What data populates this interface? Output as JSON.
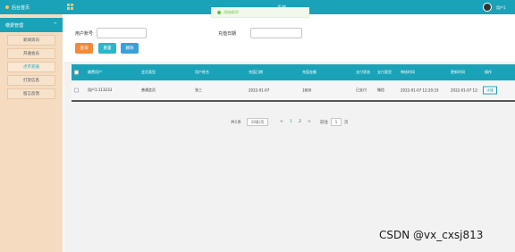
{
  "sidebar": {
    "home_label": "后台首页",
    "group_label": "缴费管理",
    "group_caret": "^",
    "items": [
      {
        "label": "新闻资讯",
        "active": false
      },
      {
        "label": "开通会员",
        "active": false
      },
      {
        "label": "点币充值",
        "active": true
      },
      {
        "label": "打赏信息",
        "active": false
      },
      {
        "label": "留言反馈",
        "active": false
      }
    ]
  },
  "topbar": {
    "title": "系统",
    "user_name": "用户1"
  },
  "toast": {
    "message": "添加成功!"
  },
  "search": {
    "user_account_label": "用户账号",
    "user_account_value": "",
    "recharge_date_label": "充值日期",
    "recharge_date_value": ""
  },
  "buttons": {
    "query": "查询",
    "reset": "重置",
    "delete": "删除"
  },
  "table": {
    "headers": [
      "缴费用户",
      "会员类型",
      "用户姓名",
      "充值日期",
      "充值金额",
      "支付状态",
      "支付类型",
      "审核时间",
      "更新时间",
      "操作"
    ],
    "rows": [
      {
        "cells": [
          "用户1:113233",
          "普通会员",
          "张三",
          "2022-01-07",
          "1800",
          "已支付",
          "微信",
          "2022-01-07 12:20:33",
          "2022-01-07 12:"
        ],
        "action": "详情"
      }
    ]
  },
  "pagination": {
    "total": "共1条",
    "page_size": "10条/页",
    "prev": "<",
    "pages": [
      "1",
      "2"
    ],
    "next": ">",
    "goto_label": "前往",
    "goto_value": "1",
    "page_suffix": "页"
  },
  "watermark": "CSDN @vx_cxsj813",
  "colors": {
    "primary": "#1aa3b8",
    "sidebar_bg": "#f5dcc0",
    "query_btn": "#f28a3a",
    "reset_btn": "#29b6c8",
    "delete_btn": "#3aa0d8",
    "toast_text": "#67c23a"
  }
}
